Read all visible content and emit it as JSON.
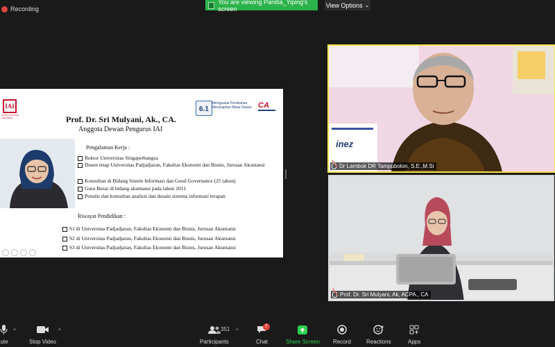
{
  "recording": {
    "label": "Recording"
  },
  "banner": {
    "text": "You are viewing Panitia_Yiping's screen",
    "view_options": "View Options"
  },
  "slide": {
    "org_logo_text": "IAI",
    "org_logo_caption": "IKATAN AKUNTAN INDONESIA",
    "badge_number": "6.1",
    "badge_text": "Menguasai Perubahan, Menyiapkan Masa Depan",
    "ca_logo": "CA",
    "title": "Prof. Dr. Sri Mulyani, Ak., CA.",
    "subtitle": "Anggota Dewan Pengurus IAI",
    "experience_heading": "Pengalaman Kerja :",
    "experience": [
      "Rektor Universitas Singaperbangsa",
      "Dosen tetap Universitas Padjadjaran, Fakultas Ekonomi dan Bisnis, Jurusan Akuntansi",
      "Konsultan di Bidang Sistem Informasi dan Good Governance (25 tahun)",
      "Guru Besar di bidang akuntansi pada tahun 2011",
      "Penulis dan konsultan analisis dan desain sistema informasi terapan"
    ],
    "education_heading": "Riwayat Pendidikan :",
    "education": [
      "S1 di Universitas Padjadjaran, Fakultas Ekonomi dan Bisnis, Jurusan Akuntansi",
      "S2 di Universitas Padjadjaran, Fakultas Ekonomi dan Bisnis, Jurusan Akuntansi",
      "S3 di Universitas Padjadjaran, Fakultas Ekonomi dan Bisnis, Jurusan Akuntansi"
    ]
  },
  "participants": [
    {
      "name": "Dr Lambok DR Tampubolon, S.E.,M.Si",
      "sign_text": "inez"
    },
    {
      "name": "Prof. Dr. Sri Mulyani, Ak, ACPA., CA"
    }
  ],
  "toolbar": {
    "mute": "ute",
    "stop_video": "Stop Video",
    "participants": "Participants",
    "participants_count": "351",
    "chat": "Chat",
    "chat_badge": "7",
    "share_screen": "Share Screen",
    "record": "Record",
    "reactions": "Reactions",
    "apps": "Apps"
  },
  "colors": {
    "banner": "#2cb24a",
    "active_speaker": "#f6e44a",
    "share_green": "#2cd04f",
    "alert": "#e0463c"
  }
}
